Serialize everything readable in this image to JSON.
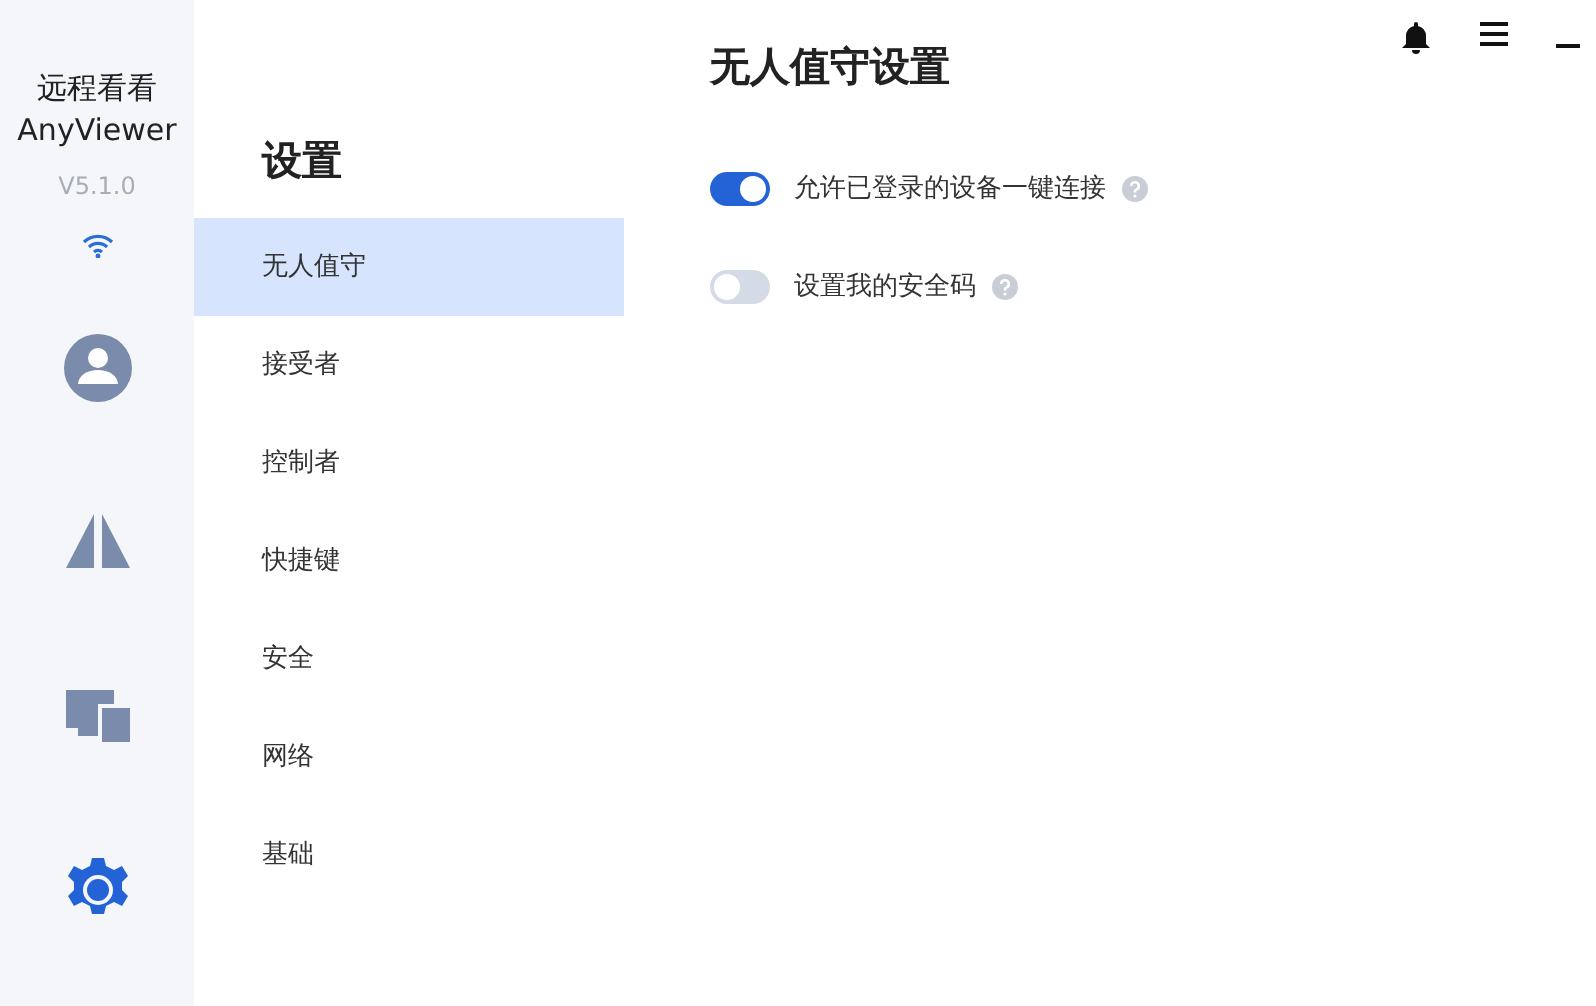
{
  "app": {
    "name": "远程看看",
    "name_en": "AnyViewer",
    "version": "V5.1.0"
  },
  "nav": [
    {
      "kind": "account",
      "selected": false
    },
    {
      "kind": "connect",
      "selected": false
    },
    {
      "kind": "devices",
      "selected": false
    },
    {
      "kind": "settings",
      "selected": true
    }
  ],
  "settings_menu": {
    "title": "设置",
    "items": [
      {
        "label": "无人值守",
        "selected": true
      },
      {
        "label": "接受者",
        "selected": false
      },
      {
        "label": "控制者",
        "selected": false
      },
      {
        "label": "快捷键",
        "selected": false
      },
      {
        "label": "安全",
        "selected": false
      },
      {
        "label": "网络",
        "selected": false
      },
      {
        "label": "基础",
        "selected": false
      }
    ]
  },
  "panel": {
    "title": "无人值守设置",
    "options": [
      {
        "label": "允许已登录的设备一键连接",
        "on": true
      },
      {
        "label": "设置我的安全码",
        "on": false
      }
    ]
  }
}
